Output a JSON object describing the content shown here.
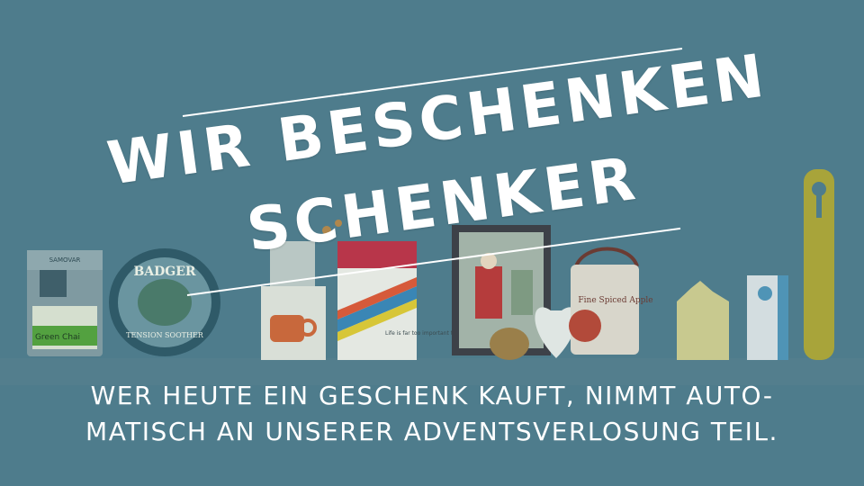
{
  "headline": {
    "line1": "WIR BESCHENKEN",
    "line2": "SCHENKER"
  },
  "subline": {
    "line1": "WER HEUTE EIN GESCHENK KAUFT, NIMMT AUTO-",
    "line2": "MATISCH AN UNSERER ADVENTSVERLOSUNG TEIL."
  },
  "products": {
    "tea_tin_label": "Green Chai",
    "balm_tin_top": "BADGER",
    "balm_tin_bottom": "TENSION SOOTHER",
    "apple_tin_label": "Fine Spiced Apple",
    "book_text": "Life is far too important to be taken seriously"
  },
  "colors": {
    "background": "#4e7c8c",
    "text": "#ffffff"
  }
}
